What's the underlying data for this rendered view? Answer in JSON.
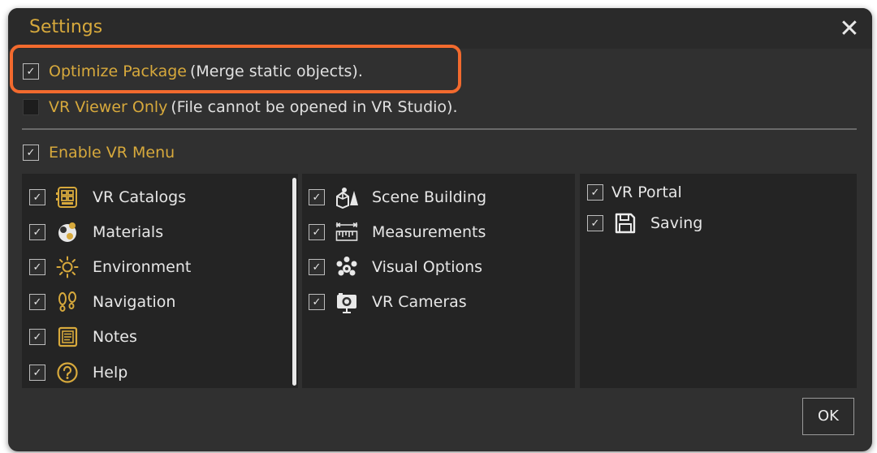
{
  "dialog": {
    "title": "Settings",
    "close_symbol": "✕",
    "ok_label": "OK"
  },
  "options": {
    "optimize": {
      "label": "Optimize Package",
      "description": "(Merge static objects).",
      "checked": true
    },
    "vr_viewer_only": {
      "label": "VR Viewer Only",
      "description": "(File cannot be opened in VR Studio).",
      "checked": false
    },
    "enable_vr_menu": {
      "label": "Enable VR Menu",
      "checked": true
    }
  },
  "menu_columns": {
    "col1": [
      {
        "label": "VR Catalogs",
        "icon": "catalog-grid-icon",
        "checked": true
      },
      {
        "label": "Materials",
        "icon": "materials-icon",
        "checked": true
      },
      {
        "label": "Environment",
        "icon": "sun-icon",
        "checked": true
      },
      {
        "label": "Navigation",
        "icon": "footprints-icon",
        "checked": true
      },
      {
        "label": "Notes",
        "icon": "notes-icon",
        "checked": true
      },
      {
        "label": "Help",
        "icon": "help-icon",
        "checked": true
      }
    ],
    "col2": [
      {
        "label": "Scene Building",
        "icon": "shapes-icon",
        "checked": true
      },
      {
        "label": "Measurements",
        "icon": "ruler-icon",
        "checked": true
      },
      {
        "label": "Visual Options",
        "icon": "paw-icon",
        "checked": true
      },
      {
        "label": "VR Cameras",
        "icon": "camera-icon",
        "checked": true
      }
    ],
    "col3": [
      {
        "label": "VR Portal",
        "icon": "",
        "checked": true
      },
      {
        "label": "Saving",
        "icon": "floppy-icon",
        "checked": true
      }
    ]
  },
  "colors": {
    "accent": "#d7a93c",
    "highlight": "#f26a2e",
    "background": "#303030",
    "panel": "#242424"
  },
  "check_glyph": "✓"
}
